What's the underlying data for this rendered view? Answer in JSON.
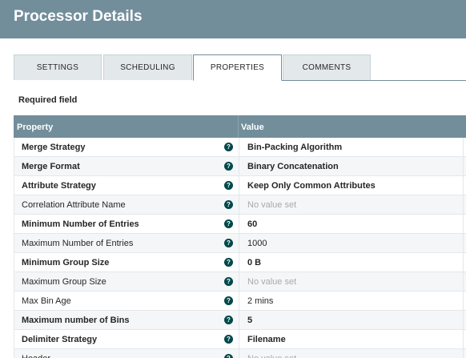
{
  "header": {
    "title": "Processor Details"
  },
  "tabs": [
    {
      "label": "SETTINGS"
    },
    {
      "label": "SCHEDULING"
    },
    {
      "label": "PROPERTIES"
    },
    {
      "label": "COMMENTS"
    }
  ],
  "active_tab": "PROPERTIES",
  "required_label": "Required field",
  "table": {
    "columns": {
      "property": "Property",
      "value": "Value"
    },
    "rows": [
      {
        "property": "Merge Strategy",
        "value": "Bin-Packing Algorithm",
        "required": true,
        "set": true
      },
      {
        "property": "Merge Format",
        "value": "Binary Concatenation",
        "required": true,
        "set": true
      },
      {
        "property": "Attribute Strategy",
        "value": "Keep Only Common Attributes",
        "required": true,
        "set": true
      },
      {
        "property": "Correlation Attribute Name",
        "value": "No value set",
        "required": false,
        "set": false
      },
      {
        "property": "Minimum Number of Entries",
        "value": "60",
        "required": true,
        "set": true
      },
      {
        "property": "Maximum Number of Entries",
        "value": "1000",
        "required": false,
        "set": true
      },
      {
        "property": "Minimum Group Size",
        "value": "0 B",
        "required": true,
        "set": true
      },
      {
        "property": "Maximum Group Size",
        "value": "No value set",
        "required": false,
        "set": false
      },
      {
        "property": "Max Bin Age",
        "value": "2 mins",
        "required": false,
        "set": true
      },
      {
        "property": "Maximum number of Bins",
        "value": "5",
        "required": true,
        "set": true
      },
      {
        "property": "Delimiter Strategy",
        "value": "Filename",
        "required": true,
        "set": true
      },
      {
        "property": "Header",
        "value": "No value set",
        "required": false,
        "set": false
      }
    ]
  },
  "icons": {
    "help": "question-circle-icon"
  },
  "colors": {
    "header_bg": "#728e9b",
    "help_icon": "#004849",
    "tab_bg": "#e3e8eb"
  }
}
